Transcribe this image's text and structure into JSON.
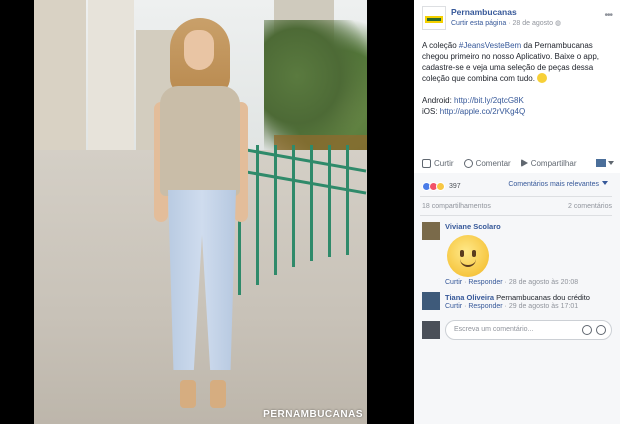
{
  "photo": {
    "watermark": "PERNAMBUCANAS"
  },
  "post": {
    "page_name": "Pernambucanas",
    "follow_label": "Curtir esta página",
    "date": "28 de agosto",
    "text_prefix": "A coleção ",
    "hashtag": "#JeansVesteBem",
    "text_rest": " da Pernambucanas chegou primeiro no nosso Aplicativo. Baixe o app, cadastre-se e veja uma seleção de peças dessa coleção que combina com tudo.",
    "android_label": "Android:",
    "android_link": "http://bit.ly/2qtcG8K",
    "ios_label": "iOS:",
    "ios_link": "http://apple.co/2rVKg4Q"
  },
  "actions": {
    "like": "Curtir",
    "comment": "Comentar",
    "share": "Compartilhar"
  },
  "stats": {
    "reaction_count": "397",
    "sort_label": "Comentários mais relevantes",
    "shares": "18 compartilhamentos",
    "comments": "2 comentários"
  },
  "comments": [
    {
      "author": "Viviane Scolaro",
      "like": "Curtir",
      "reply": "Responder",
      "time": "28 de agosto às 20:08"
    },
    {
      "author": "Tiana Oliveira",
      "text": " Pernambucanas dou crédito",
      "like": "Curtir",
      "reply": "Responder",
      "time": "29 de agosto às 17:01"
    }
  ],
  "composer": {
    "placeholder": "Escreva um comentário..."
  }
}
